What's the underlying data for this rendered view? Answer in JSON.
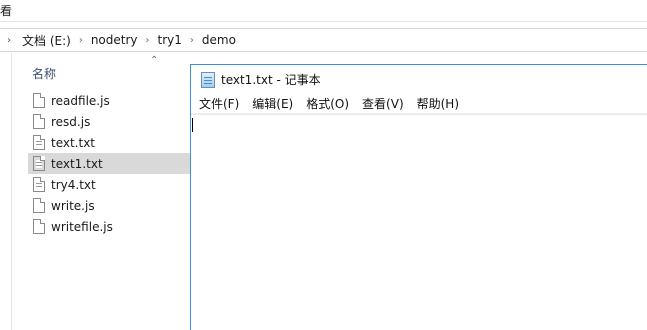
{
  "explorer": {
    "ribbon_tab": "看",
    "breadcrumb": [
      "文档 (E:)",
      "nodetry",
      "try1",
      "demo"
    ],
    "column_header": "名称",
    "files": [
      {
        "name": "readfile.js",
        "type": "js",
        "selected": false
      },
      {
        "name": "resd.js",
        "type": "js",
        "selected": false
      },
      {
        "name": "text.txt",
        "type": "txt",
        "selected": false
      },
      {
        "name": "text1.txt",
        "type": "txt",
        "selected": true
      },
      {
        "name": "try4.txt",
        "type": "txt",
        "selected": false
      },
      {
        "name": "write.js",
        "type": "js",
        "selected": false
      },
      {
        "name": "writefile.js",
        "type": "js",
        "selected": false
      }
    ]
  },
  "notepad": {
    "title": "text1.txt - 记事本",
    "menu": [
      "文件(F)",
      "编辑(E)",
      "格式(O)",
      "查看(V)",
      "帮助(H)"
    ],
    "content": "",
    "accent_color": "#3c8fd6"
  }
}
